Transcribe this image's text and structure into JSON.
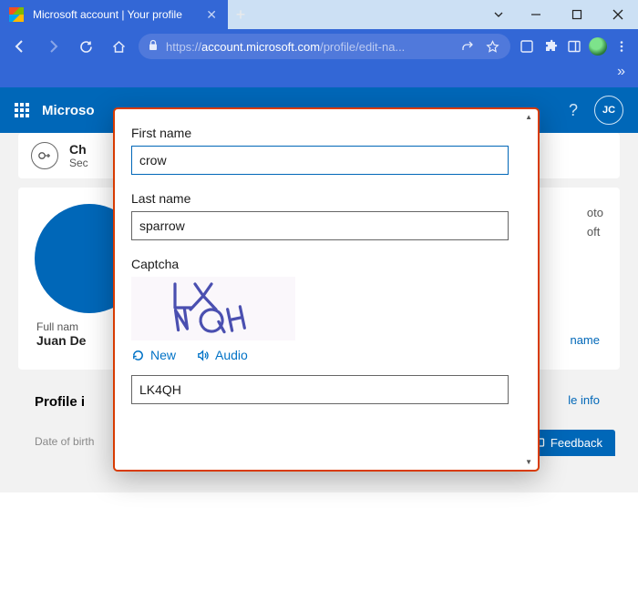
{
  "window": {
    "tab_title": "Microsoft account | Your profile",
    "url_host": "account.microsoft.com",
    "url_path": "/profile/edit-na..."
  },
  "header": {
    "brand": "Microso",
    "avatar_initials": "JC"
  },
  "page": {
    "alert_title": "Ch",
    "alert_sub": "Sec",
    "side_text_1": "oto",
    "side_text_2": "oft",
    "full_name_label": "Full nam",
    "full_name_value": "Juan De",
    "edit_name": "name",
    "profile_info_header": "Profile i",
    "edit_profile": "le info",
    "dob_label": "Date of birth",
    "feedback": "Feedback"
  },
  "modal": {
    "first_name_label": "First name",
    "first_name_value": "crow",
    "last_name_label": "Last name",
    "last_name_value": "sparrow",
    "captcha_label": "Captcha",
    "captcha_text": "LK4QH",
    "new_label": "New",
    "audio_label": "Audio",
    "captcha_input": "LK4QH"
  }
}
